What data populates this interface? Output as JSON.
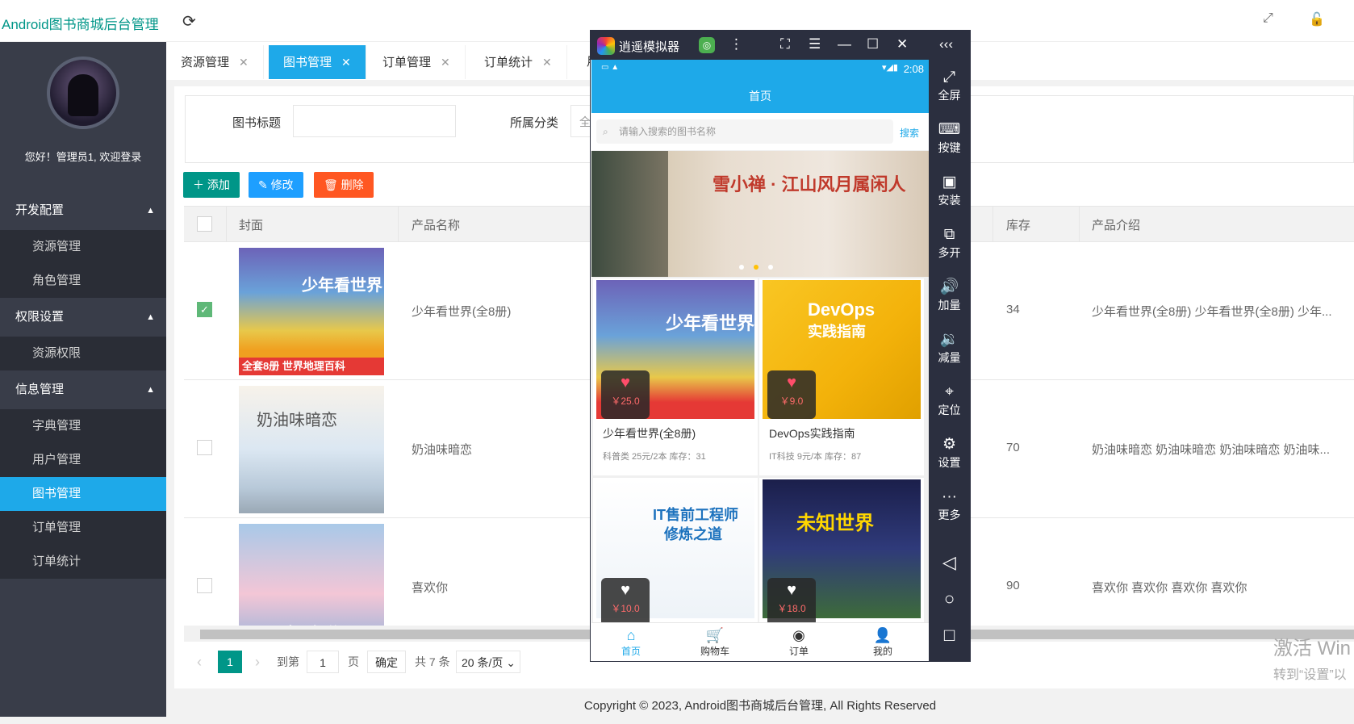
{
  "app": {
    "title": "Android图书商城后台管理"
  },
  "user": {
    "welcome": "您好！管理员1, 欢迎登录"
  },
  "menu": {
    "groups": [
      {
        "label": "开发配置",
        "items": [
          "资源管理",
          "角色管理"
        ]
      },
      {
        "label": "权限设置",
        "items": [
          "资源权限"
        ]
      },
      {
        "label": "信息管理",
        "items": [
          "字典管理",
          "用户管理",
          "图书管理",
          "订单管理",
          "订单统计"
        ]
      }
    ],
    "active": "图书管理"
  },
  "tabs": [
    "资源管理",
    "图书管理",
    "订单管理",
    "订单统计",
    "用"
  ],
  "filter": {
    "title_label": "图书标题",
    "category_label": "所属分类",
    "category_value": "全"
  },
  "toolbar": {
    "add": "添加",
    "edit": "修改",
    "delete": "删除"
  },
  "table": {
    "headers": {
      "cover": "封面",
      "name": "产品名称",
      "stock": "库存",
      "intro": "产品介绍"
    },
    "rows": [
      {
        "name": "少年看世界(全8册)",
        "stock": "34",
        "intro": "少年看世界(全8册) 少年看世界(全8册) 少年...",
        "checked": true
      },
      {
        "name": "奶油味暗恋",
        "stock": "70",
        "intro": "奶油味暗恋 奶油味暗恋 奶油味暗恋 奶油味...",
        "checked": false
      },
      {
        "name": "喜欢你",
        "stock": "90",
        "intro": "喜欢你 喜欢你 喜欢你 喜欢你",
        "checked": false
      }
    ]
  },
  "pager": {
    "current": "1",
    "goto_label": "到第",
    "page_value": "1",
    "page_unit": "页",
    "confirm": "确定",
    "total": "共 7 条",
    "size": "20 条/页"
  },
  "footer": "Copyright © 2023, Android图书商城后台管理, All Rights Reserved",
  "watermark": {
    "line1": "激活 Win",
    "line2": "转到“设置”以"
  },
  "emulator": {
    "title": "逍遥模拟器",
    "side": [
      "全屏",
      "按键",
      "安装",
      "多开",
      "加量",
      "减量",
      "定位",
      "设置",
      "更多"
    ],
    "time": "2:08",
    "page_title": "首页",
    "search_placeholder": "请输入搜索的图书名称",
    "search_button": "搜索",
    "banner_text": "雪小禅 · 江山风月属闲人",
    "books": [
      {
        "name": "少年看世界(全8册)",
        "price": "￥25.0",
        "info": "科普类  25元/2本 库存：31"
      },
      {
        "name": "DevOps实践指南",
        "price": "￥9.0",
        "info": "IT科技  9元/本 库存：87"
      },
      {
        "price": "￥10.0"
      },
      {
        "price": "￥18.0"
      }
    ],
    "tabbar": [
      "首页",
      "购物车",
      "订单",
      "我的"
    ]
  }
}
